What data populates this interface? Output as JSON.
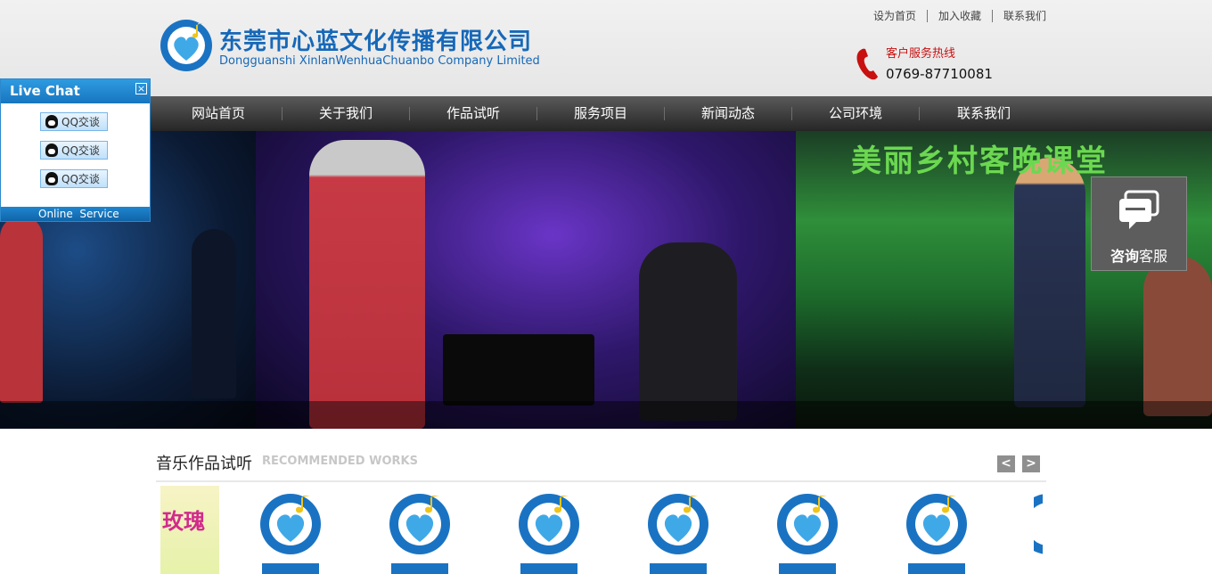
{
  "header": {
    "company_cn": "东莞市心蓝文化传播有限公司",
    "company_en": "Dongguanshi XinlanWenhuaChuanbo Company Limited",
    "top_links": [
      "设为首页",
      "加入收藏",
      "联系我们"
    ],
    "hotline_label": "客户服务热线",
    "hotline_number": "0769-87710081",
    "brand_color": "#1668b8"
  },
  "nav": {
    "items": [
      "网站首页",
      "关于我们",
      "作品试听",
      "服务项目",
      "新闻动态",
      "公司环境",
      "联系我们"
    ]
  },
  "banner": {
    "right_title": "美丽乡村客晚课堂"
  },
  "live_chat": {
    "title": "Live Chat",
    "close_glyph": "×",
    "buttons": [
      "QQ交谈",
      "QQ交谈",
      "QQ交谈"
    ],
    "footer": "Online  Service"
  },
  "consult": {
    "label_bold": "咨询",
    "label_rest": "客服"
  },
  "works": {
    "title": "音乐作品试听",
    "subtitle": "RECOMMENDED WORKS",
    "prev": "<",
    "next": ">",
    "first_thumb_text": "玫瑰"
  }
}
